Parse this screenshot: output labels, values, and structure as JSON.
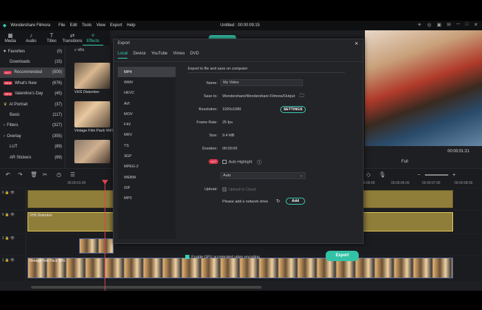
{
  "app": {
    "name": "Wondershare Filmora",
    "menu": [
      "File",
      "Edit",
      "Tools",
      "View",
      "Export",
      "Help"
    ],
    "window_title": "Untitled : 00:00:09:15"
  },
  "toolbar": {
    "items": [
      {
        "label": "Media",
        "icon": "media-icon"
      },
      {
        "label": "Audio",
        "icon": "audio-icon"
      },
      {
        "label": "Titles",
        "icon": "titles-icon"
      },
      {
        "label": "Transitions",
        "icon": "transitions-icon"
      },
      {
        "label": "Effects",
        "icon": "effects-icon",
        "active": true
      }
    ]
  },
  "effects_panel": {
    "categories": [
      {
        "label": "Favorites",
        "count": "(0)"
      },
      {
        "label": "Downloads",
        "count": "(15)"
      },
      {
        "label": "Recommended",
        "count": "(500)",
        "selected": true,
        "badge": "HOT"
      },
      {
        "label": "What's New",
        "count": "(676)",
        "badge": "NEW"
      },
      {
        "label": "Valentine's Day",
        "count": "(45)",
        "badge": "NEW"
      },
      {
        "label": "AI Portrait",
        "count": "(37)"
      },
      {
        "label": "Basic",
        "count": "(117)"
      },
      {
        "label": "Filters",
        "count": "(327)"
      },
      {
        "label": "Overlay",
        "count": "(355)"
      },
      {
        "label": "LUT",
        "count": "(89)"
      },
      {
        "label": "AR Stickers",
        "count": "(69)"
      }
    ],
    "search_value": "vhs",
    "thumbnails": [
      {
        "label": "VHS Distortion"
      },
      {
        "label": "Vintage Film Pack VHS"
      }
    ]
  },
  "preview": {
    "timecode": "00:00:01:21",
    "quality": "Full"
  },
  "timeline": {
    "ruler": [
      "00:00:01:00",
      "00:00:05:00",
      "00:00:06:00",
      "00:00:07:00",
      "00:00:08:00"
    ],
    "tracks": [
      "6",
      "5",
      "2",
      "1"
    ],
    "clip_labels": [
      "VHS Distortion",
      "Vintage Film Pack VHS"
    ]
  },
  "export_dialog": {
    "title": "Export",
    "tabs": [
      "Local",
      "Device",
      "YouTube",
      "Vimeo",
      "DVD"
    ],
    "active_tab": "Local",
    "formats": [
      "MP4",
      "WMV",
      "HEVC",
      "AVI",
      "MOV",
      "F4V",
      "MKV",
      "TS",
      "3GP",
      "MPEG-2",
      "WEBM",
      "GIF",
      "MP3"
    ],
    "selected_format": "MP4",
    "heading": "Export to file and save on computer",
    "name_label": "Name:",
    "name_value": "My Video",
    "save_label": "Save to:",
    "save_value": "Wondershare/Wondershare Filmora/Output",
    "resolution_label": "Resolution:",
    "resolution_value": "1920x1080",
    "settings_button": "SETTINGS",
    "framerate_label": "Frame Rate:",
    "framerate_value": "25 fps",
    "size_label": "Size:",
    "size_value": "9.4 MB",
    "duration_label": "Duration:",
    "duration_value": "00:00:09",
    "hot_badge": "HOT",
    "auto_highlight": "Auto Highlight",
    "auto_select": "Auto",
    "upload_label": "Upload:",
    "upload_to_cloud": "Upload to Cloud",
    "network_drive_text": "Please add a network drive",
    "add_button": "Add",
    "gpu_label": "Enable GPU accelerated video encoding",
    "export_button": "Export"
  },
  "colors": {
    "accent": "#36d1b7",
    "hot": "#d8334a",
    "clip": "#8f7d3a"
  }
}
